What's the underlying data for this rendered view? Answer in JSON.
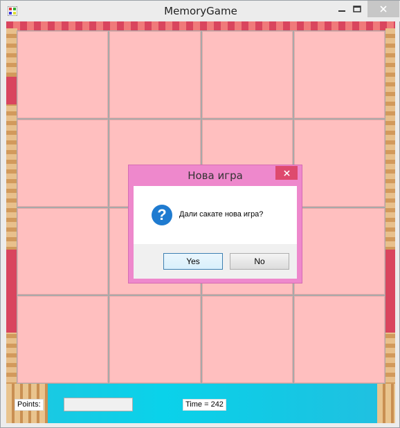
{
  "window": {
    "title": "MemoryGame"
  },
  "board": {
    "rows": 4,
    "columns": 4
  },
  "status": {
    "points_label": "Points:",
    "points_value": "",
    "time_label": "Time = 242"
  },
  "dialog": {
    "title": "Нова игра",
    "message": "Дали сакате нова игра?",
    "yes_label": "Yes",
    "no_label": "No",
    "icon": "question-icon"
  },
  "colors": {
    "card": "#ffbfbf",
    "dialog_frame": "#ee88cc",
    "dialog_close": "#de4a6e"
  }
}
